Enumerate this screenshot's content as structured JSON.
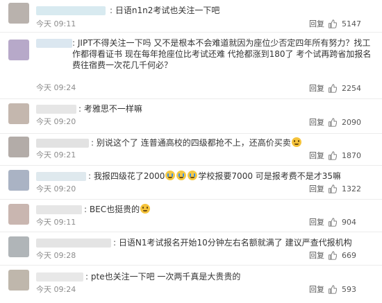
{
  "comments": [
    {
      "text": "日语n1n2考试也关注一下吧",
      "time": "今天 09:11",
      "reply": "回复",
      "likes": "5147",
      "avatar_color": "#b9b2ad",
      "name_color": "#cfe6ee"
    },
    {
      "text": "JIPT不得关注一下吗 又不是根本不会难道就因为座位少否定四年所有努力？找工作都得看证书 现在每年抢座位比考试还难 代抢都涨到180了 考个试再跨省加报名费往宿费一次花几千何必？",
      "time": "今天 09:24",
      "reply": "回复",
      "likes": "2254",
      "avatar_color": "#b7a9c9",
      "name_color": "#d8e6f0"
    },
    {
      "text": "考雅思不一样嘛",
      "time": "今天 09:20",
      "reply": "回复",
      "likes": "2090",
      "avatar_color": "#c4b7ae",
      "name_color": "#e6e6e6"
    },
    {
      "text_before": "别说这个了 连普通高校的四级都抢不上，还高价买卖",
      "text_after": "",
      "time": "今天 09:21",
      "reply": "回复",
      "likes": "1870",
      "avatar_color": "#b3aca8",
      "name_color": "#e2e2e2"
    },
    {
      "text_before": "我报四级花了2000",
      "text_after": "学校报要7000 可是报考费不是才35嘛",
      "time": "今天 09:20",
      "reply": "回复",
      "likes": "1322",
      "avatar_color": "#aab3c4",
      "name_color": "#dfe9ee"
    },
    {
      "text_before": "BEC也挺贵的",
      "text_after": "",
      "time": "今天 09:11",
      "reply": "回复",
      "likes": "904",
      "avatar_color": "#c9b6b0",
      "name_color": "#e6e6e6"
    },
    {
      "text": "日语N1考试报名开始10分钟左右名额就满了 建议严查代报机构",
      "time": "今天 09:28",
      "reply": "回复",
      "likes": "669",
      "avatar_color": "#b0b5b8",
      "name_color": "#e4e4e4"
    },
    {
      "text": "pte也关注一下吧 一次两千真是大贵贵的",
      "time": "今天 09:24",
      "reply": "回复",
      "likes": "593",
      "avatar_color": "#bfb7ac",
      "name_color": "#e8e8e8"
    }
  ],
  "emoji_names": [
    "smile-emoji",
    "cry-emoji"
  ],
  "like_icon": "thumbs-up-icon"
}
